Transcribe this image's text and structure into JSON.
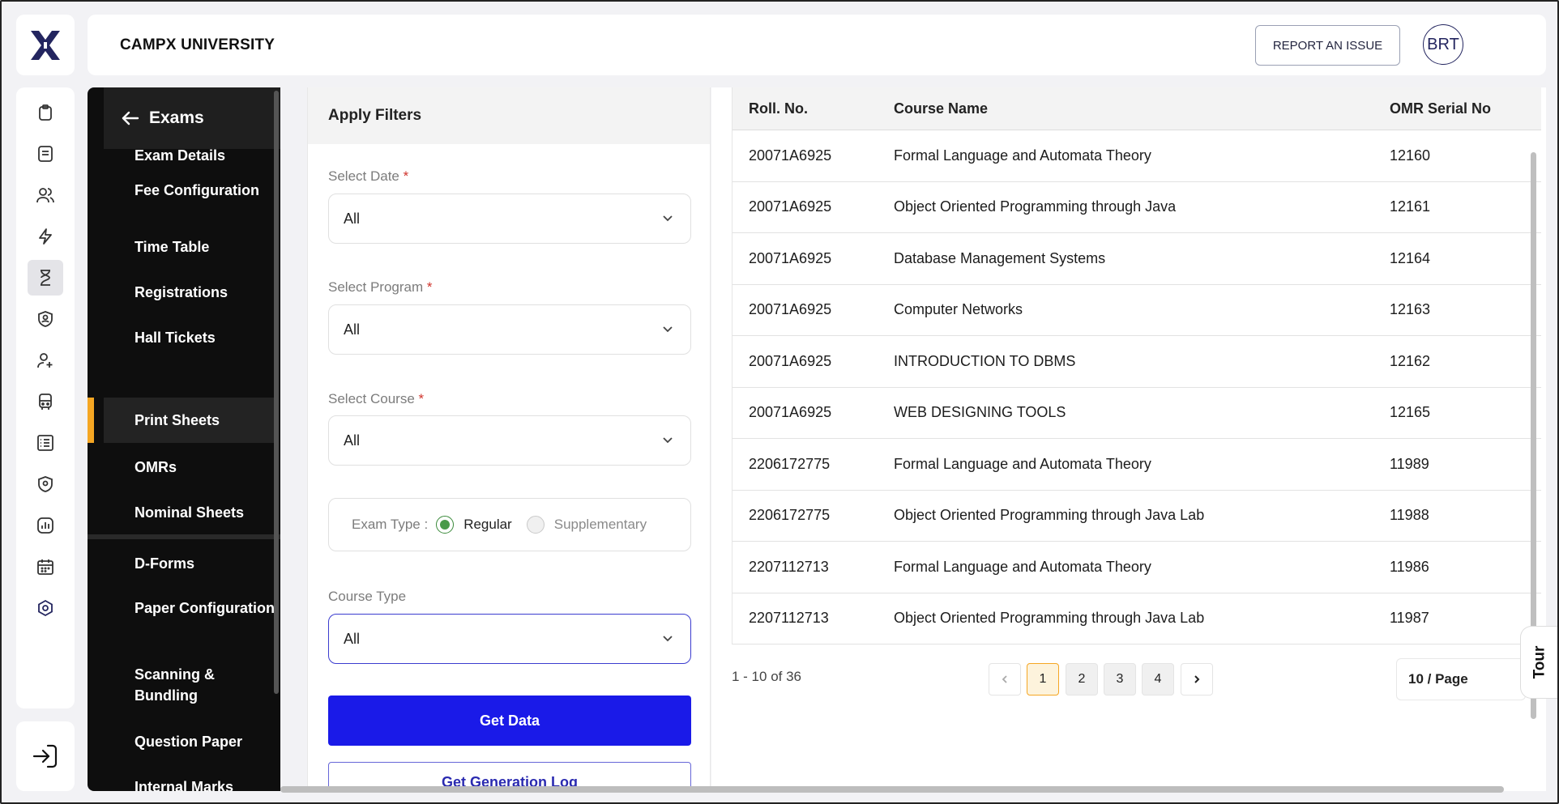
{
  "header": {
    "university": "CAMPX UNIVERSITY",
    "report_label": "REPORT AN ISSUE",
    "avatar_initials": "BRT"
  },
  "sidebar": {
    "back_title": "Exams",
    "items": [
      {
        "label": "Exam Details",
        "active": false
      },
      {
        "label": "Fee Configuration",
        "active": false
      },
      {
        "label": "Time Table",
        "active": false
      },
      {
        "label": "Registrations",
        "active": false
      },
      {
        "label": "Hall Tickets",
        "active": false
      },
      {
        "label": "Print Sheets",
        "active": true
      },
      {
        "label": "OMRs",
        "active": false
      },
      {
        "label": "Nominal Sheets",
        "active": false
      },
      {
        "label": "D-Forms",
        "active": false
      },
      {
        "label": "Paper Configuration",
        "active": false
      },
      {
        "label": "Scanning & Bundling",
        "active": false
      },
      {
        "label": "Question Paper",
        "active": false
      },
      {
        "label": "Internal Marks",
        "active": false
      }
    ]
  },
  "rail_icons": [
    "clipboard-icon",
    "document-icon",
    "users-icon",
    "lightning-icon",
    "hourglass-icon",
    "shield-user-icon",
    "user-plus-icon",
    "bus-icon",
    "list-icon",
    "location-shield-icon",
    "chart-icon",
    "calendar-icon",
    "settings-hex-icon"
  ],
  "filters": {
    "title": "Apply Filters",
    "date_label": "Select Date",
    "date_value": "All",
    "program_label": "Select Program",
    "program_value": "All",
    "course_label": "Select Course",
    "course_value": "All",
    "required_mark": "*",
    "exam_type_label": "Exam Type :",
    "exam_type_options": [
      "Regular",
      "Supplementary"
    ],
    "exam_type_selected": "Regular",
    "course_type_label": "Course Type",
    "course_type_value": "All",
    "get_data_label": "Get Data",
    "gen_log_label": "Get Generation Log"
  },
  "table": {
    "columns": [
      "Roll. No.",
      "Course Name",
      "OMR Serial No"
    ],
    "rows": [
      [
        "20071A6925",
        "Formal Language and Automata Theory",
        "12160"
      ],
      [
        "20071A6925",
        "Object Oriented Programming through Java",
        "12161"
      ],
      [
        "20071A6925",
        "Database Management Systems",
        "12164"
      ],
      [
        "20071A6925",
        "Computer Networks",
        "12163"
      ],
      [
        "20071A6925",
        "INTRODUCTION TO DBMS",
        "12162"
      ],
      [
        "20071A6925",
        "WEB DESIGNING TOOLS",
        "12165"
      ],
      [
        "2206172775",
        "Formal Language and Automata Theory",
        "11989"
      ],
      [
        "2206172775",
        "Object Oriented Programming through Java Lab",
        "11988"
      ],
      [
        "2207112713",
        "Formal Language and Automata Theory",
        "11986"
      ],
      [
        "2207112713",
        "Object Oriented Programming through Java Lab",
        "11987"
      ]
    ]
  },
  "pagination": {
    "info": "1 - 10 of 36",
    "pages": [
      "1",
      "2",
      "3",
      "4"
    ],
    "current_page": "1",
    "per_page": "10 / Page"
  },
  "tour_label": "Tour",
  "colors": {
    "accent": "#f5a623",
    "primary_button": "#1a1ae8",
    "nav_bg": "#0e0e0e",
    "brand": "#23255f"
  }
}
